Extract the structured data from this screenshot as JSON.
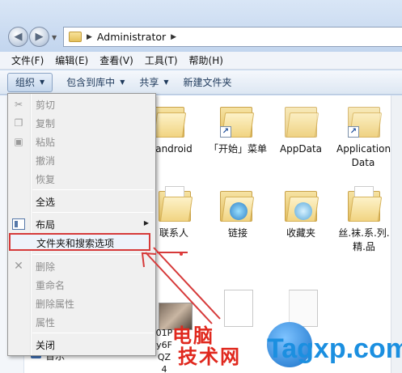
{
  "address_bar": {
    "path": "Administrator"
  },
  "menubar": [
    {
      "label": "文件(F)"
    },
    {
      "label": "编辑(E)"
    },
    {
      "label": "查看(V)"
    },
    {
      "label": "工具(T)"
    },
    {
      "label": "帮助(H)"
    }
  ],
  "commandbar": {
    "organize": "组织",
    "include": "包含到库中",
    "share": "共享",
    "new_folder": "新建文件夹"
  },
  "files": [
    {
      "label": "android"
    },
    {
      "label": "「开始」菜单"
    },
    {
      "label": "AppData"
    },
    {
      "label": "Application Data"
    },
    {
      "label": "联系人"
    },
    {
      "label": "链接"
    },
    {
      "label": "收藏夹"
    },
    {
      "label": "丝.袜.系.列.精.品"
    },
    {
      "label": "01P y6F QZ4"
    }
  ],
  "navpane": {
    "visible_item": "音乐"
  },
  "dropdown": {
    "items": [
      {
        "label": "剪切",
        "icon": "scissors-icon"
      },
      {
        "label": "复制",
        "icon": "copy-icon"
      },
      {
        "label": "粘贴",
        "icon": "paste-icon"
      },
      {
        "label": "撤消"
      },
      {
        "label": "恢复"
      },
      {
        "label": "全选"
      },
      {
        "label": "布局",
        "icon": "layout-icon"
      },
      {
        "label": "文件夹和搜索选项"
      },
      {
        "label": "删除",
        "icon": "delete-x-icon"
      },
      {
        "label": "重命名"
      },
      {
        "label": "删除属性"
      },
      {
        "label": "属性"
      },
      {
        "label": "关闭"
      }
    ]
  },
  "watermark": {
    "cn_line1": "电脑",
    "cn_line2": "技术网",
    "en": "Tagxp.com"
  },
  "colors": {
    "highlight_box": "#d63a3a",
    "watermark_red": "#e0281e",
    "watermark_blue": "#1b8fe0"
  }
}
